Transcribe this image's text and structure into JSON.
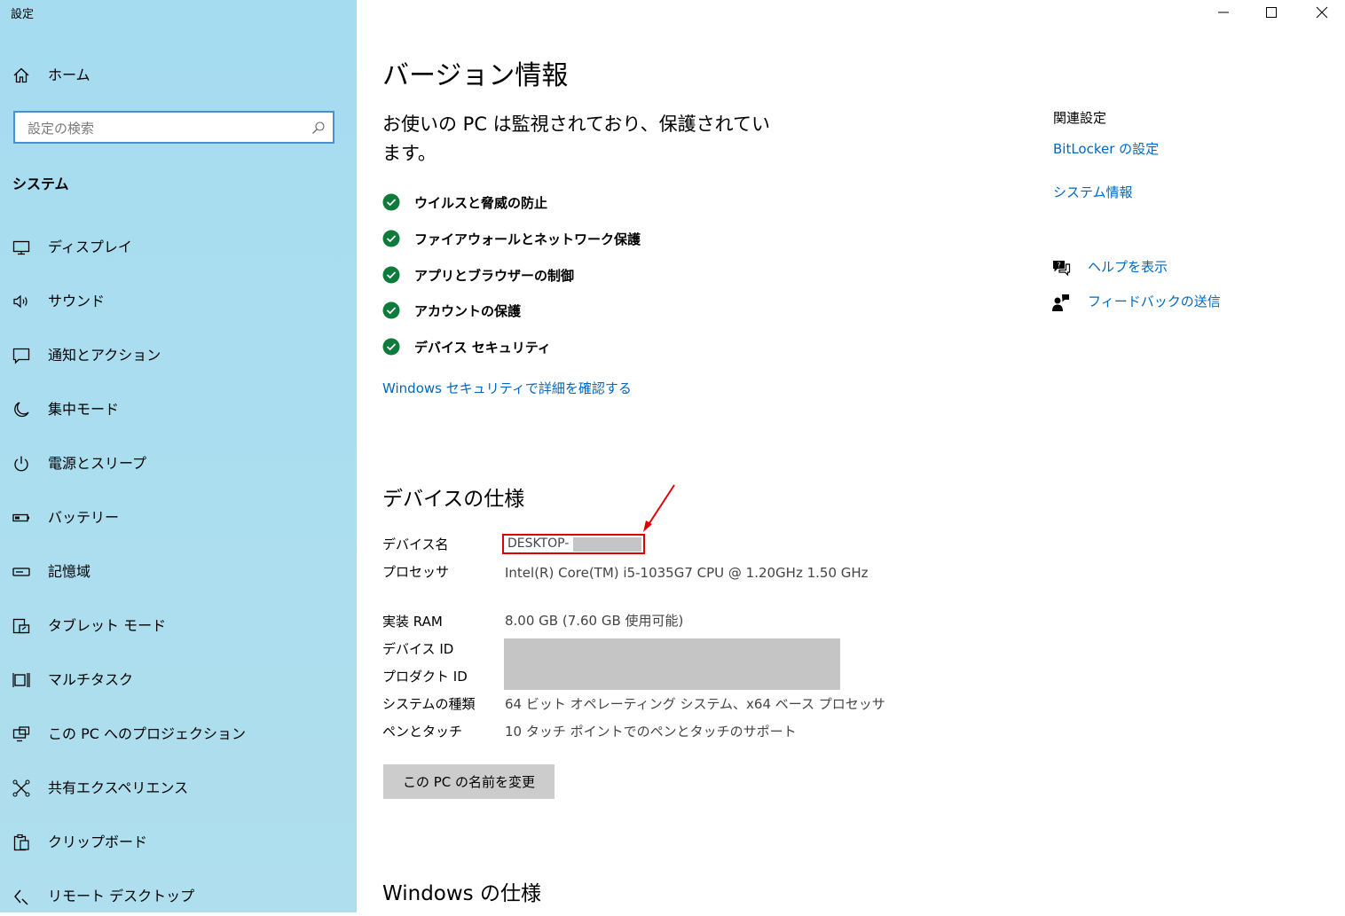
{
  "window": {
    "title": "設定"
  },
  "sidebar": {
    "home_label": "ホーム",
    "search_placeholder": "設定の検索",
    "section_label": "システム",
    "items": [
      {
        "label": "ディスプレイ",
        "icon": "display-icon"
      },
      {
        "label": "サウンド",
        "icon": "sound-icon"
      },
      {
        "label": "通知とアクション",
        "icon": "notification-icon"
      },
      {
        "label": "集中モード",
        "icon": "moon-icon"
      },
      {
        "label": "電源とスリープ",
        "icon": "power-icon"
      },
      {
        "label": "バッテリー",
        "icon": "battery-icon"
      },
      {
        "label": "記憶域",
        "icon": "storage-icon"
      },
      {
        "label": "タブレット モード",
        "icon": "tablet-icon"
      },
      {
        "label": "マルチタスク",
        "icon": "multitask-icon"
      },
      {
        "label": "この PC へのプロジェクション",
        "icon": "projection-icon"
      },
      {
        "label": "共有エクスペリエンス",
        "icon": "share-icon"
      },
      {
        "label": "クリップボード",
        "icon": "clipboard-icon"
      },
      {
        "label": "リモート デスクトップ",
        "icon": "remote-desktop-icon"
      }
    ]
  },
  "main": {
    "title": "バージョン情報",
    "status_heading": "お使いの PC は監視されており、保護されています。",
    "protections": [
      "ウイルスと脅威の防止",
      "ファイアウォールとネットワーク保護",
      "アプリとブラウザーの制御",
      "アカウントの保護",
      "デバイス セキュリティ"
    ],
    "security_link": "Windows セキュリティで詳細を確認する",
    "device_specs_heading": "デバイスの仕様",
    "specs": {
      "device_name": {
        "label": "デバイス名",
        "value": "DESKTOP-"
      },
      "processor": {
        "label": "プロセッサ",
        "value": "Intel(R) Core(TM) i5-1035G7 CPU @ 1.20GHz   1.50 GHz"
      },
      "ram": {
        "label": "実装 RAM",
        "value": "8.00 GB (7.60 GB 使用可能)"
      },
      "device_id": {
        "label": "デバイス ID"
      },
      "product_id": {
        "label": "プロダクト ID"
      },
      "system_type": {
        "label": "システムの種類",
        "value": "64 ビット オペレーティング システム、x64 ベース プロセッサ"
      },
      "pen_touch": {
        "label": "ペンとタッチ",
        "value": "10 タッチ ポイントでのペンとタッチのサポート"
      }
    },
    "rename_button": "この PC の名前を変更",
    "windows_specs_heading": "Windows の仕様"
  },
  "related": {
    "title": "関連設定",
    "bitlocker_link": "BitLocker の設定",
    "system_info_link": "システム情報",
    "help_link": "ヘルプを表示",
    "feedback_link": "フィードバックの送信"
  },
  "colors": {
    "accent": "#0067c0",
    "sidebar_bg": "#a6dcf0",
    "check_green": "#0e7a3c",
    "annotation_red": "#e00000"
  }
}
